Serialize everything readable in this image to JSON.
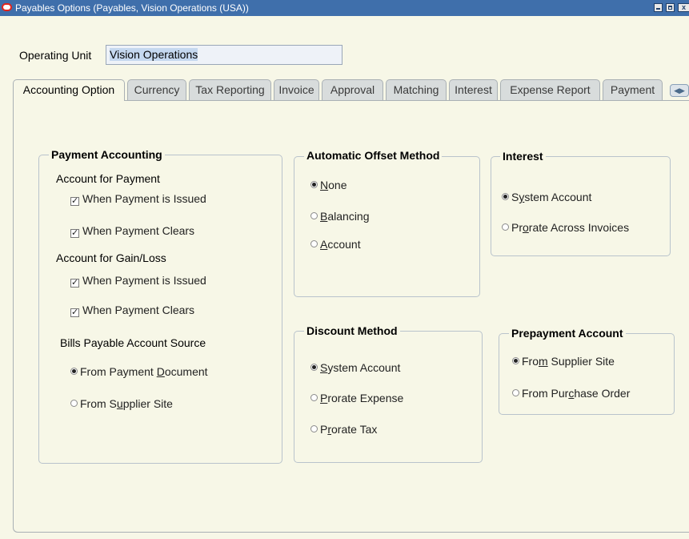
{
  "window": {
    "title": "Payables Options (Payables, Vision Operations (USA))",
    "titlebar_color": "#3f6fab",
    "close_glyph": "x"
  },
  "operating_unit": {
    "label": "Operating Unit",
    "value": "Vision Operations"
  },
  "tabs": [
    {
      "label": "Accounting Option",
      "active": true
    },
    {
      "label": "Currency"
    },
    {
      "label": "Tax Reporting"
    },
    {
      "label": "Invoice"
    },
    {
      "label": "Approval"
    },
    {
      "label": "Matching"
    },
    {
      "label": "Interest"
    },
    {
      "label": "Expense Report"
    },
    {
      "label": "Payment"
    }
  ],
  "payment_accounting": {
    "title": "Payment Accounting",
    "account_for_payment_label": "Account for Payment",
    "payment_issued": {
      "label": "When Payment is Issued",
      "checked": true
    },
    "payment_clears": {
      "label": "When Payment Clears",
      "checked": true
    },
    "account_for_gain_loss_label": "Account for Gain/Loss",
    "gain_issued": {
      "label": "When Payment is Issued",
      "checked": true
    },
    "gain_clears": {
      "label": "When Payment Clears",
      "checked": true
    },
    "bills_payable_label": "Bills Payable Account Source",
    "bills_options": [
      {
        "label": "From Payment Document",
        "selected": true
      },
      {
        "label": "From Supplier Site",
        "selected": false
      }
    ]
  },
  "automatic_offset": {
    "title": "Automatic Offset Method",
    "options": [
      {
        "label": "None",
        "selected": true
      },
      {
        "label": "Balancing",
        "selected": false
      },
      {
        "label": "Account",
        "selected": false
      }
    ]
  },
  "interest": {
    "title": "Interest",
    "options": [
      {
        "label": "System Account",
        "selected": true
      },
      {
        "label": "Prorate Across Invoices",
        "selected": false
      }
    ]
  },
  "discount_method": {
    "title": "Discount Method",
    "options": [
      {
        "label": "System Account",
        "selected": true
      },
      {
        "label": "Prorate Expense",
        "selected": false
      },
      {
        "label": "Prorate Tax",
        "selected": false
      }
    ]
  },
  "prepayment_account": {
    "title": "Prepayment Account",
    "options": [
      {
        "label": "From Supplier Site",
        "selected": true
      },
      {
        "label": "From Purchase Order",
        "selected": false
      }
    ]
  }
}
